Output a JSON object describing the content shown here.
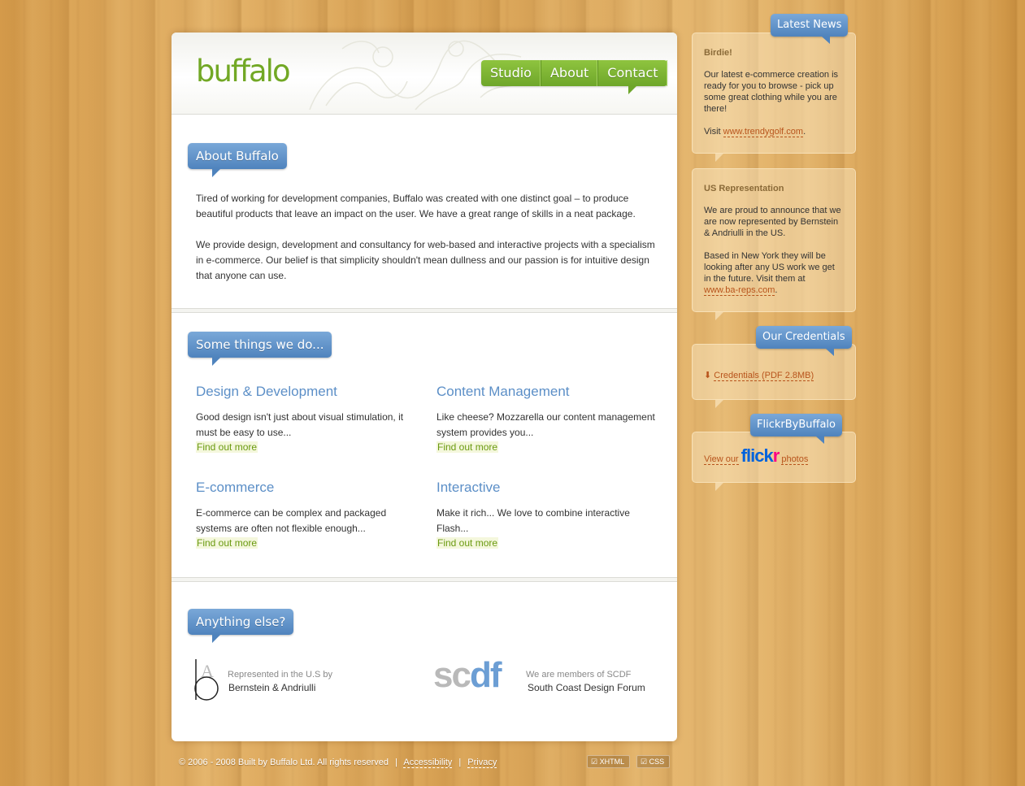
{
  "brand": {
    "logo": "buffalo",
    "colors": {
      "green": "#72a825",
      "blue": "#5c8fc7",
      "link_orange": "#b8541c"
    }
  },
  "nav": {
    "items": [
      "Studio",
      "About",
      "Contact"
    ]
  },
  "about": {
    "heading": "About Buffalo",
    "paragraphs": [
      "Tired of working for development companies, Buffalo was created with one distinct goal – to produce beautiful products that leave an impact on the user. We have a great range of skills in a neat package.",
      "We provide design, development and consultancy for web-based and interactive projects with a specialism in e-commerce. Our belief is that simplicity shouldn't mean dullness and our passion is for intuitive design that anyone can use."
    ]
  },
  "services": {
    "heading": "Some things we do...",
    "items": [
      {
        "title": "Design & Development",
        "text": "Good design isn't just about visual stimulation, it must be easy to use...",
        "more": "Find out more"
      },
      {
        "title": "Content Management",
        "text": "Like cheese? Mozzarella our content management system provides you...",
        "more": "Find out more"
      },
      {
        "title": "E-commerce",
        "text": "E-commerce can be complex and packaged systems are often not flexible enough...",
        "more": "Find out more"
      },
      {
        "title": "Interactive",
        "text": "Make it rich... We love to combine interactive Flash...",
        "more": "Find out more"
      }
    ]
  },
  "else": {
    "heading": "Anything else?",
    "ba": {
      "line1": "Represented in the U.S by",
      "line2": "Bernstein & Andriulli"
    },
    "scdf": {
      "logo_a": "sc",
      "logo_b": "df",
      "line1": "We are members of SCDF",
      "line2": "South Coast Design Forum"
    }
  },
  "footer": {
    "copyright": "© 2006 - 2008 Built by Buffalo Ltd. All rights reserved",
    "sep": "|",
    "accessibility": "Accessibility",
    "privacy": "Privacy",
    "xhtml": "XHTML",
    "css": "CSS"
  },
  "sidebar": {
    "news": {
      "badge": "Latest News",
      "title": "Birdie!",
      "text": "Our latest e-commerce creation is ready for you to browse - pick up some great clothing while you are there!",
      "visit": "Visit ",
      "link": "www.trendygolf.com",
      "end": "."
    },
    "us": {
      "title": "US Representation",
      "text1": "We are proud to announce that we are now represented by Bernstein & Andriulli in the US.",
      "text2": "Based in New York they will be looking after any US work we get in the future. Visit them at",
      "link": "www.ba-reps.com",
      "end": "."
    },
    "credentials": {
      "badge": "Our Credentials",
      "link": "Credentials (PDF 2.8MB)"
    },
    "flickr": {
      "badge": "FlickrByBuffalo",
      "pre": "View our",
      "logo_a": "flick",
      "logo_b": "r",
      "post": "photos"
    }
  }
}
